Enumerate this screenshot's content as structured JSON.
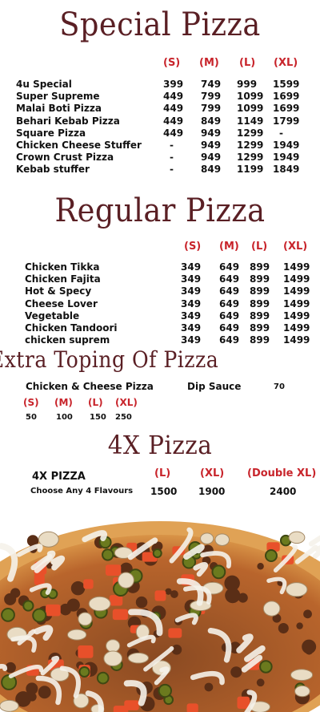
{
  "special": {
    "title": "Special Pizza",
    "headers": [
      "(S)",
      "(M)",
      "(L)",
      "(XL)"
    ],
    "rows": [
      {
        "name": "4u Special",
        "prices": [
          "399",
          "749",
          "999",
          "1599"
        ]
      },
      {
        "name": "Super Supreme",
        "prices": [
          "449",
          "799",
          "1099",
          "1699"
        ]
      },
      {
        "name": "Malai Boti Pizza",
        "prices": [
          "449",
          "799",
          "1099",
          "1699"
        ]
      },
      {
        "name": "Behari  Kebab Pizza",
        "prices": [
          "449",
          "849",
          "1149",
          "1799"
        ]
      },
      {
        "name": "Square Pizza",
        "prices": [
          "449",
          "949",
          "1299",
          "-"
        ]
      },
      {
        "name": "Chicken Cheese Stuffer",
        "prices": [
          "-",
          "949",
          "1299",
          "1949"
        ]
      },
      {
        "name": "Crown Crust Pizza",
        "prices": [
          "-",
          "949",
          "1299",
          "1949"
        ]
      },
      {
        "name": "Kebab stuffer",
        "prices": [
          "-",
          "849",
          "1199",
          "1849"
        ]
      }
    ]
  },
  "regular": {
    "title": "Regular Pizza",
    "headers": [
      "(S)",
      "(M)",
      "(L)",
      "(XL)"
    ],
    "rows": [
      {
        "name": "Chicken Tikka",
        "prices": [
          "349",
          "649",
          "899",
          "1499"
        ]
      },
      {
        "name": "Chicken Fajita",
        "prices": [
          "349",
          "649",
          "899",
          "1499"
        ]
      },
      {
        "name": "Hot & Specy",
        "prices": [
          "349",
          "649",
          "899",
          "1499"
        ]
      },
      {
        "name": "Cheese Lover",
        "prices": [
          "349",
          "649",
          "899",
          "1499"
        ]
      },
      {
        "name": "Vegetable",
        "prices": [
          "349",
          "649",
          "899",
          "1499"
        ]
      },
      {
        "name": "Chicken Tandoori",
        "prices": [
          "349",
          "649",
          "899",
          "1499"
        ]
      },
      {
        "name": "chicken suprem",
        "prices": [
          "349",
          "649",
          "899",
          "1499"
        ]
      }
    ]
  },
  "extra": {
    "title": "Extra Toping Of Pizza",
    "item": "Chicken & Cheese Pizza",
    "dip_label": "Dip Sauce",
    "dip_price": "70",
    "headers": [
      "(S)",
      "(M)",
      "(L)",
      "(XL)"
    ],
    "prices": [
      "50",
      "100",
      "150",
      "250"
    ]
  },
  "fourx": {
    "title": "4X Pizza",
    "name": "4X PIZZA",
    "subtitle": "Choose Any 4 Flavours",
    "headers": [
      "(L)",
      "(XL)",
      "(Double XL)"
    ],
    "prices": [
      "1500",
      "1900",
      "2400"
    ]
  },
  "colors": {
    "title": "#5a1f24",
    "header": "#c8242b"
  }
}
